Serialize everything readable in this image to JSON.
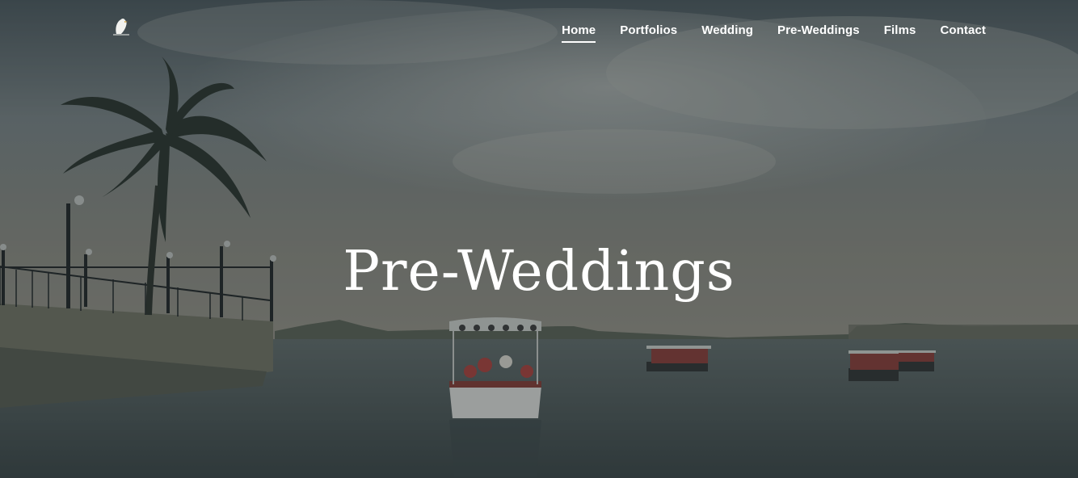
{
  "site": {
    "logo_icon": "bird-logo-icon"
  },
  "nav": {
    "items": [
      {
        "label": "Home",
        "active": true
      },
      {
        "label": "Portfolios"
      },
      {
        "label": "Wedding"
      },
      {
        "label": "Pre-Weddings"
      },
      {
        "label": "Films"
      },
      {
        "label": "Contact"
      }
    ]
  },
  "hero": {
    "title": "Pre-Weddings",
    "colors": {
      "overlay": "#1e2628",
      "sky": "#7b8687",
      "water": "#4f5b5c"
    }
  }
}
